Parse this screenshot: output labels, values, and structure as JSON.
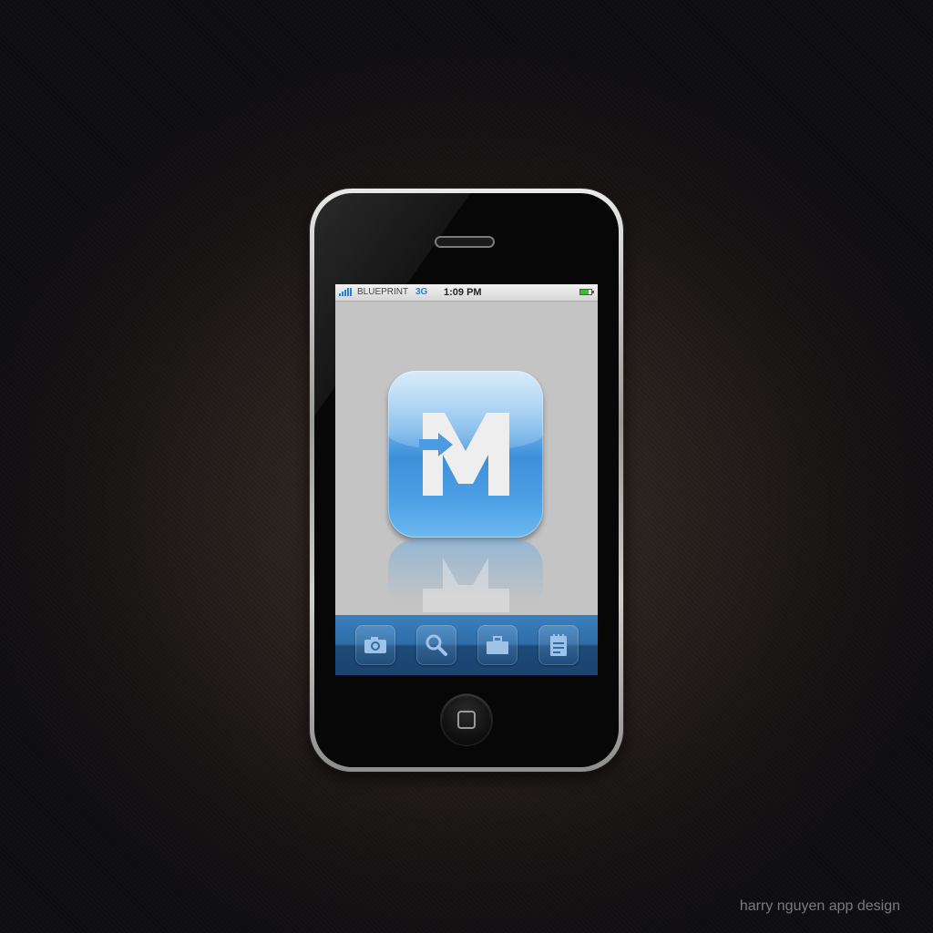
{
  "status_bar": {
    "carrier": "BLUEPRINT",
    "network": "3G",
    "time": "1:09 PM",
    "signal_icon": "signal-bars-icon",
    "battery_icon": "battery-icon"
  },
  "app": {
    "logo_letter": "M",
    "icon_name": "app-m-logo-icon"
  },
  "dock": {
    "items": [
      {
        "icon": "camera-icon"
      },
      {
        "icon": "search-icon"
      },
      {
        "icon": "briefcase-icon"
      },
      {
        "icon": "notepad-icon"
      }
    ]
  },
  "watermark": "harry nguyen app design",
  "colors": {
    "accent_blue": "#3d8fd9",
    "dock_blue": "#2f6ea8",
    "screen_gray": "#c4c4c4",
    "battery_green": "#3cbd2b"
  }
}
